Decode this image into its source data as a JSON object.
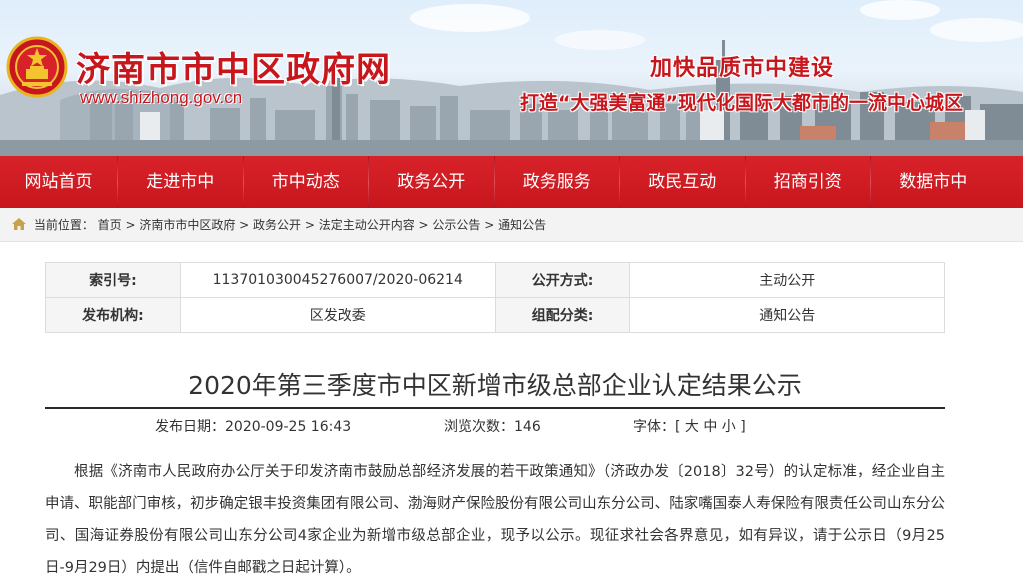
{
  "header": {
    "site_title": "济南市市中区政府网",
    "site_url": "www.shizhong.gov.cn",
    "slogan_main": "加快品质市中建设",
    "slogan_sub": "打造“大强美富通”现代化国际大都市的一流中心城区",
    "emblem_icon": "national-emblem-icon"
  },
  "nav": {
    "items": [
      "网站首页",
      "走进市中",
      "市中动态",
      "政务公开",
      "政务服务",
      "政民互动",
      "招商引资",
      "数据市中"
    ]
  },
  "breadcrumb": {
    "label": "当前位置：",
    "path": "首页 > 济南市市中区政府 > 政务公开 > 法定主动公开内容 > 公示公告 > 通知公告"
  },
  "info_table": {
    "index_label": "索引号:",
    "index_value": "113701030045276007/2020-06214",
    "public_mode_label": "公开方式:",
    "public_mode_value": "主动公开",
    "publisher_label": "发布机构:",
    "publisher_value": "区发改委",
    "category_label": "组配分类:",
    "category_value": "通知公告"
  },
  "article": {
    "title": "2020年第三季度市中区新增市级总部企业认定结果公示",
    "publish_date": "发布日期：2020-09-25 16:43",
    "views": "浏览次数：146",
    "font_size": "字体：[ 大 中 小 ]",
    "body": "根据《济南市人民政府办公厅关于印发济南市鼓励总部经济发展的若干政策通知》（济政办发〔2018〕32号）的认定标准，经企业自主申请、职能部门审核，初步确定银丰投资集团有限公司、渤海财产保险股份有限公司山东分公司、陆家嘴国泰人寿保险有限责任公司山东分公司、国海证券股份有限公司山东分公司4家企业为新增市级总部企业，现予以公示。现征求社会各界意见，如有异议，请于公示日（9月25日-9月29日）内提出（信件自邮戳之日起计算）。"
  },
  "colors": {
    "brand_red": "#c8161d",
    "nav_red": "#d8222a"
  }
}
